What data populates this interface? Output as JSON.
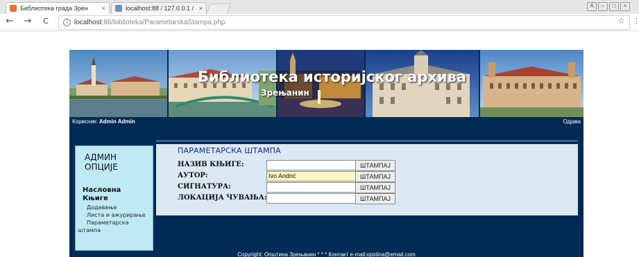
{
  "browser": {
    "tabs": [
      {
        "title": "Библиотека града Зрен"
      },
      {
        "title": "localhost:88 / 127.0.0.1 /"
      }
    ],
    "url": {
      "host": "localhost",
      "path": ":88/biblioteka/ParametarskaStampa.php"
    },
    "icons": {
      "back": "←",
      "forward": "→",
      "reload": "C",
      "info": "i",
      "bookmark": "☆",
      "menu": "⋮",
      "close": "×"
    }
  },
  "banner": {
    "title": "Библиотека историјског архива",
    "subtitle": "Зрењанин"
  },
  "userbar": {
    "label": "Корисник:",
    "user": "Admin Admin",
    "logout": "Одјава"
  },
  "sidebar": {
    "heading": "АДМИН ОПЦИЈЕ",
    "section1": "Насловна",
    "section2": "Књиге",
    "links": [
      "Додавање",
      "Листа и ажурирање",
      "Параметарска",
      "штампа"
    ]
  },
  "form": {
    "title": "ПАРАМЕТАРСКА ШТАМПА",
    "rows": [
      {
        "label": "НАЗИВ КЊИГЕ:",
        "value": "",
        "button": "ШТАМПАЈ"
      },
      {
        "label": "АУТОР:",
        "value": "Ivo Andrić",
        "button": "ШТАМПАЈ"
      },
      {
        "label": "СИГНАТУРА:",
        "value": "",
        "button": "ШТАМПАЈ"
      },
      {
        "label": "ЛОКАЦИЈА ЧУВАЊА:",
        "value": "",
        "button": "ШТАМПАЈ"
      }
    ]
  },
  "footer": {
    "text": "Copyright: Општина Зрењанин * * * Контакт e-mail:opstina@email.com"
  },
  "colors": {
    "page_bg": "#002b55",
    "sidebar_bg": "#bfe9f5",
    "content_bg": "#dbe7f3",
    "title_blue": "#0d2b88",
    "filled_input": "#fbf5c3"
  }
}
